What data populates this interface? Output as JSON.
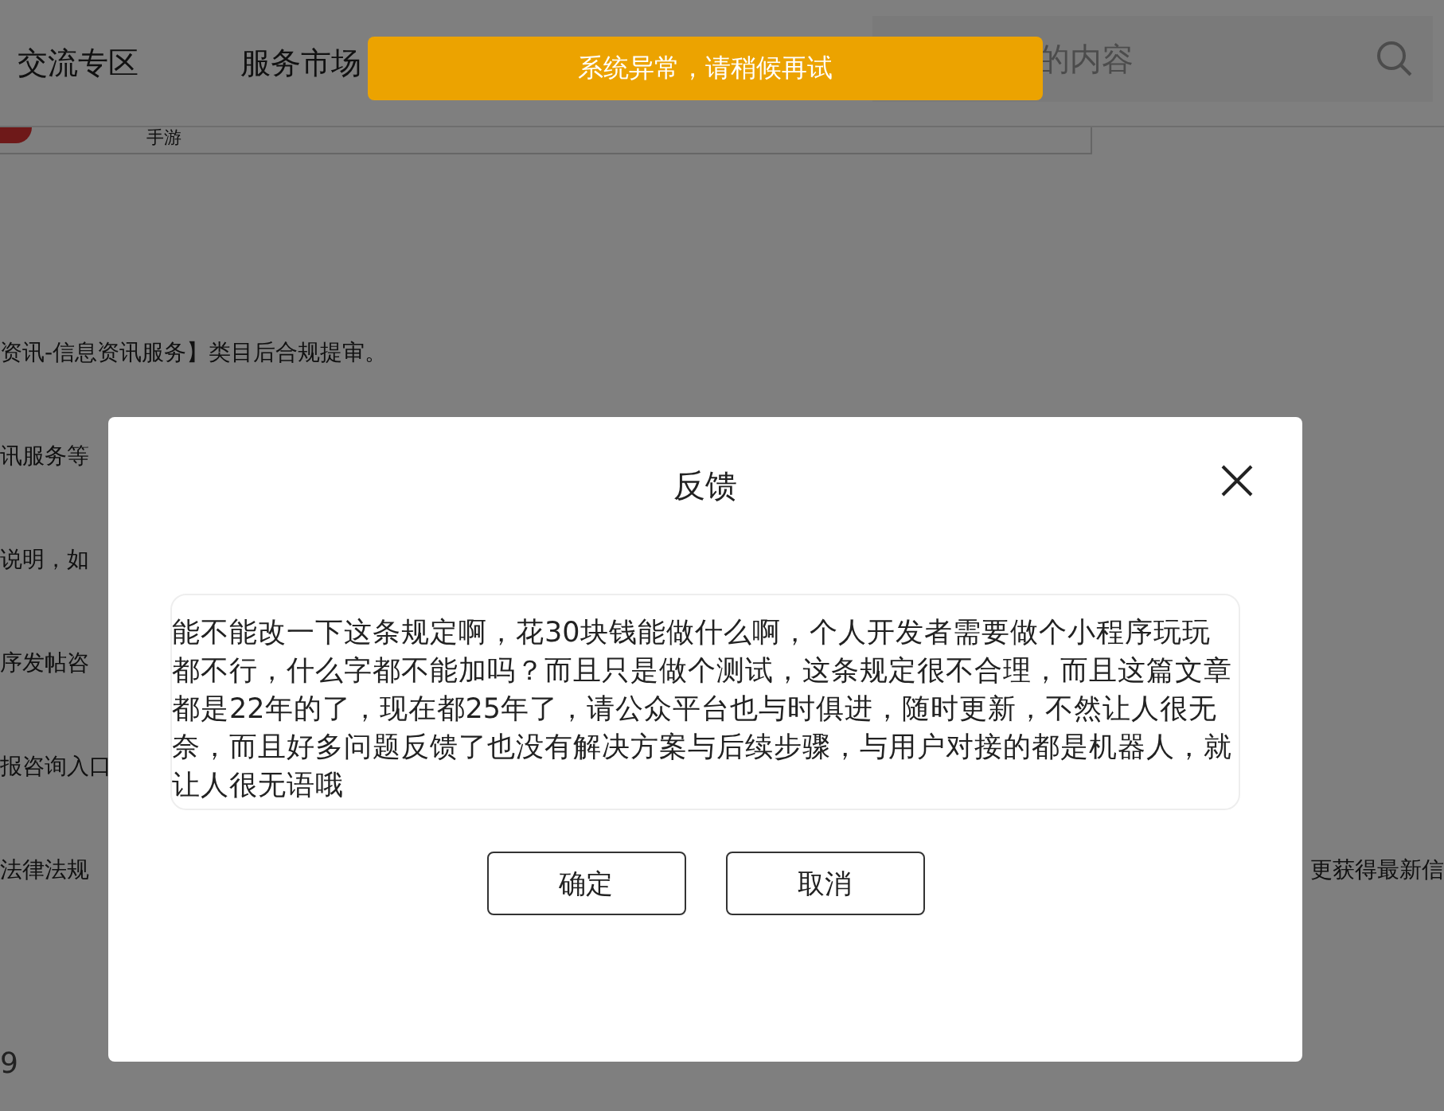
{
  "header": {
    "nav": [
      {
        "label": "交流专区"
      },
      {
        "label": "服务市场"
      }
    ],
    "search": {
      "placeholder": "的内容"
    }
  },
  "background": {
    "card_label": "手游",
    "lines": [
      {
        "left": "资讯-信息资讯服务】类目后合规提审。"
      },
      {
        "left": "讯服务等"
      },
      {
        "left": "说明，如"
      },
      {
        "left": "序发帖咨"
      },
      {
        "left": "报咨询入口"
      },
      {
        "left": "法律法规",
        "right": "更获得最新信"
      }
    ],
    "footer_number": "9"
  },
  "toast": {
    "message": "系统异常，请稍候再试"
  },
  "dialog": {
    "title": "反馈",
    "feedback": "能不能改一下这条规定啊，花30块钱能做什么啊，个人开发者需要做个小程序玩玩都不行，什么字都不能加吗？而且只是做个测试，这条规定很不合理，而且这篇文章都是22年的了，现在都25年了，请公众平台也与时俱进，随时更新，不然让人很无奈，而且好多问题反馈了也没有解决方案与后续步骤，与用户对接的都是机器人，就让人很无语哦",
    "buttons": [
      {
        "label": "确定"
      },
      {
        "label": "取消"
      }
    ]
  }
}
